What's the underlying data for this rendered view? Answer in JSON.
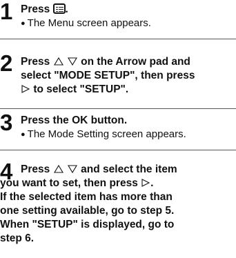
{
  "steps": [
    {
      "number": "1",
      "main_a": "Press",
      "main_b": ".",
      "icon": "menu-button-icon",
      "sub": "The Menu screen appears."
    },
    {
      "number": "2",
      "line1_a": "Press",
      "line1_b": "on the Arrow pad and",
      "line2": "select \"MODE SETUP\", then press",
      "line3": "to select \"SETUP\"."
    },
    {
      "number": "3",
      "main": "Press the OK button.",
      "sub": "The Mode Setting screen appears."
    },
    {
      "number": "4",
      "line1_a": "Press",
      "line1_b": "and select the item",
      "line2_a": "you want to set, then press",
      "line2_b": ".",
      "line3": "If the selected item has more than",
      "line4": "one setting available, go to step 5.",
      "line5": "When \"SETUP\" is displayed, go to",
      "line6": "step 6."
    }
  ],
  "bullet": "●"
}
